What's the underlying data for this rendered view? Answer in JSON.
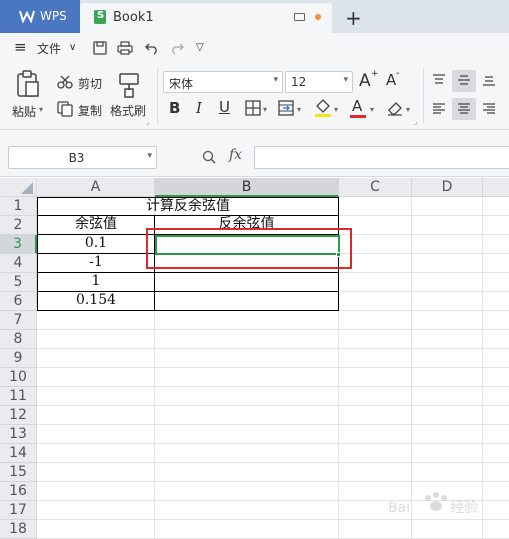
{
  "titlebar": {
    "app_tab": "WPS",
    "doc_tab": "Book1",
    "add_tab": "+"
  },
  "menu": {
    "hamburger": "≡",
    "file_label": "文件",
    "file_arrow": "∨",
    "more_arrow": "▽"
  },
  "toolbar": {
    "paste": "粘贴",
    "cut": "剪切",
    "copy": "复制",
    "format_painter": "格式刷",
    "font_name": "宋体",
    "font_size": "12",
    "grow_font": "A",
    "shrink_font": "A",
    "bold": "B",
    "italic": "I",
    "underline": "U",
    "font_color_letter": "A"
  },
  "formula_bar": {
    "name_box": "B3",
    "fx": "fx",
    "formula": ""
  },
  "grid": {
    "columns": [
      "A",
      "B",
      "C",
      "D"
    ],
    "rows": [
      "1",
      "2",
      "3",
      "4",
      "5",
      "6",
      "7",
      "8",
      "9",
      "10",
      "11",
      "12",
      "13",
      "14",
      "15",
      "16",
      "17",
      "18"
    ],
    "title": "计算反余弦值",
    "header_a": "余弦值",
    "header_b": "反余弦值",
    "values_a": [
      "0.1",
      "-1",
      "1",
      "0.154"
    ]
  },
  "colors": {
    "wps_tab": "#4b76c2",
    "selection": "#2e9a48",
    "highlight_box": "#e02828"
  }
}
